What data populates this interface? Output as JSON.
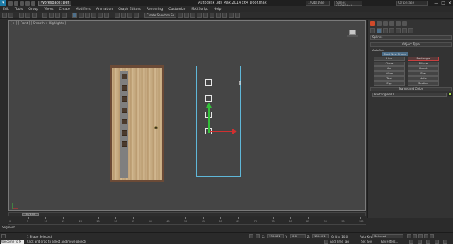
{
  "titlebar": {
    "logo": "3",
    "workspace": "Workspace: Def",
    "title": "Autodesk 3ds Max  2014 x64     Door.max",
    "search_left": "192b(198)",
    "search_mid": "Sanes (2f04294)",
    "search_right": "Or phrase",
    "win_min": "—",
    "win_max": "□",
    "win_close": "✕"
  },
  "menu": [
    "Edit",
    "Tools",
    "Group",
    "Views",
    "Create",
    "Modifiers",
    "Animation",
    "Graph Editors",
    "Rendering",
    "Customize",
    "MAXScript",
    "Help"
  ],
  "toolbar": {
    "selection_set_dropdown": "Create Selection Se"
  },
  "viewport": {
    "label": "[ + ] [ Front ] [ Smooth + Highlights ]"
  },
  "command_panel": {
    "category_dropdown": "Splines",
    "object_type_header": "Object Type",
    "autogrid_label": "AutoGrid",
    "start_new_shape_label": "Start New Shape",
    "object_buttons": [
      "Line",
      "Rectangle",
      "Circle",
      "Ellipse",
      "Arc",
      "Donut",
      "NGon",
      "Star",
      "Text",
      "Helix",
      "Egg",
      "Section"
    ],
    "active_button": "Rectangle",
    "name_color_header": "Name and Color",
    "object_name": "Rectangle001",
    "object_color": "#a6d94a"
  },
  "timeline": {
    "slider_label": "0 / 100",
    "ticks": [
      "0",
      "5",
      "10",
      "15",
      "20",
      "25",
      "30",
      "35",
      "40",
      "45",
      "50",
      "55",
      "60",
      "65",
      "70",
      "75",
      "80",
      "85",
      "90",
      "95",
      "100"
    ]
  },
  "segment_label": "Segment",
  "statusbar": {
    "listener": "Welcome to M",
    "selection": "1 Shape Selected",
    "prompt": "Click and drag to select and move objects",
    "x_label": "X:",
    "x_value": "130.431",
    "y_label": "Y:",
    "y_value": "0.0",
    "z_label": "Z:",
    "z_value": "150.001",
    "grid": "Grid = 10.0",
    "add_time_tag": "Add Time Tag",
    "auto_key": "Auto Key",
    "set_key": "Set Key",
    "selected_dropdown": "Selected",
    "key_filters": "Key Filters..."
  }
}
